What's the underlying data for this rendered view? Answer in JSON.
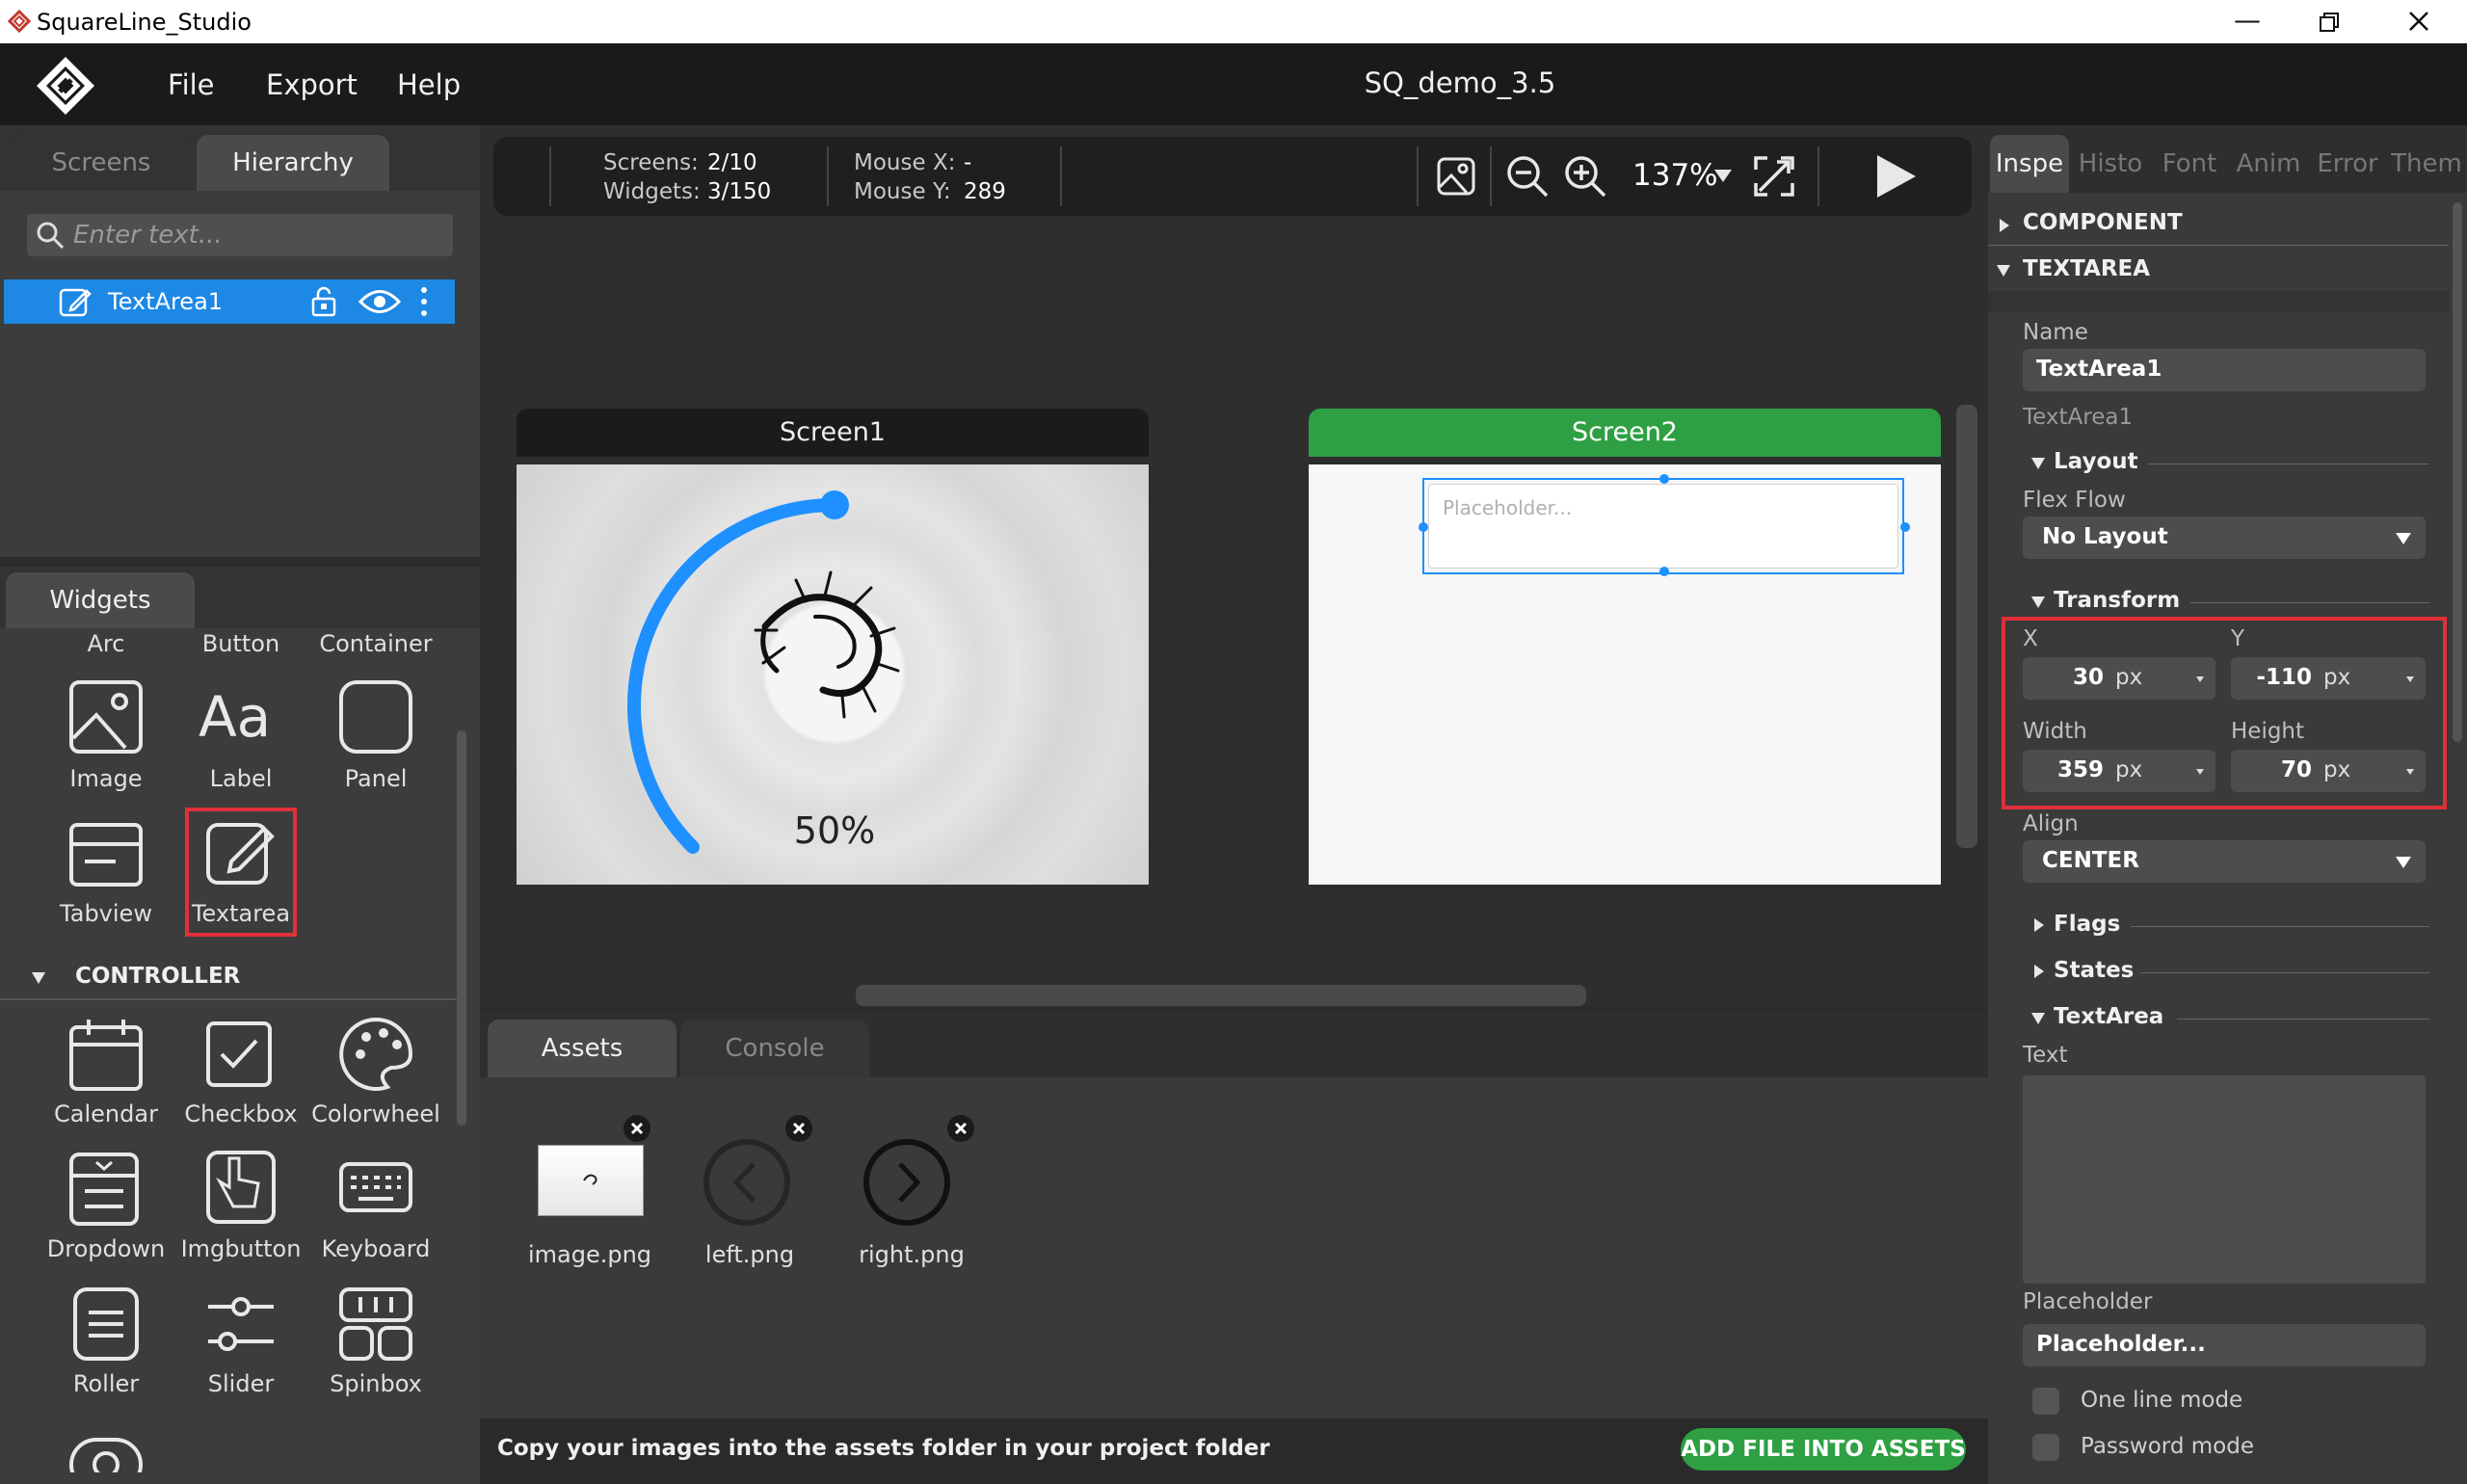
{
  "window": {
    "title": "SquareLine_Studio"
  },
  "menu": {
    "items": [
      "File",
      "Export",
      "Help"
    ],
    "project_title": "SQ_demo_3.5"
  },
  "left_top": {
    "tabs": [
      "Screens",
      "Hierarchy"
    ],
    "search_placeholder": "Enter text...",
    "hierarchy_item": "TextArea1"
  },
  "widgets": {
    "tab": "Widgets",
    "partial_row": [
      "Arc",
      "Button",
      "Container"
    ],
    "basic": [
      "Image",
      "Label",
      "Panel",
      "Tabview",
      "Textarea"
    ],
    "controller_header": "CONTROLLER",
    "controller": [
      "Calendar",
      "Checkbox",
      "Colorwheel",
      "Dropdown",
      "Imgbutton",
      "Keyboard",
      "Roller",
      "Slider",
      "Spinbox"
    ]
  },
  "toolbar": {
    "screens_label": "Screens:",
    "screens_value": "2/10",
    "widgets_label": "Widgets:",
    "widgets_value": "3/150",
    "mouse_x_label": "Mouse X:",
    "mouse_x_value": "-",
    "mouse_y_label": "Mouse Y:",
    "mouse_y_value": "289",
    "zoom": "137%"
  },
  "canvas": {
    "screen1": {
      "title": "Screen1",
      "arc_text": "50%",
      "arc_value": 0.5
    },
    "screen2": {
      "title": "Screen2",
      "textarea_placeholder": "Placeholder..."
    }
  },
  "bottom": {
    "tabs": [
      "Assets",
      "Console"
    ],
    "assets": [
      "image.png",
      "left.png",
      "right.png"
    ],
    "hint": "Copy your images into the assets folder in your project folder",
    "add_button": "ADD FILE INTO ASSETS"
  },
  "inspector": {
    "tabs": [
      "Inspe",
      "Histo",
      "Font",
      "Anim",
      "Error",
      "Them"
    ],
    "component_header": "COMPONENT",
    "textarea_header": "TEXTAREA",
    "name_label": "Name",
    "name_value": "TextArea1",
    "type_label": "TextArea1",
    "layout_header": "Layout",
    "flex_flow_label": "Flex Flow",
    "flex_flow_value": "No Layout",
    "transform_header": "Transform",
    "x_label": "X",
    "x_value": "30",
    "x_unit": "px",
    "y_label": "Y",
    "y_value": "-110",
    "y_unit": "px",
    "width_label": "Width",
    "width_value": "359",
    "width_unit": "px",
    "height_label": "Height",
    "height_value": "70",
    "height_unit": "px",
    "align_label": "Align",
    "align_value": "CENTER",
    "flags_header": "Flags",
    "states_header": "States",
    "textarea_section": "TextArea",
    "text_label": "Text",
    "text_value": "",
    "placeholder_label": "Placeholder",
    "placeholder_value": "Placeholder...",
    "one_line_label": "One line mode",
    "password_label": "Password mode"
  },
  "colors": {
    "accent_blue": "#1e90ff",
    "screen2_green": "#2ea043",
    "highlight_red": "#e0303a",
    "add_button_green": "#2ea043"
  }
}
